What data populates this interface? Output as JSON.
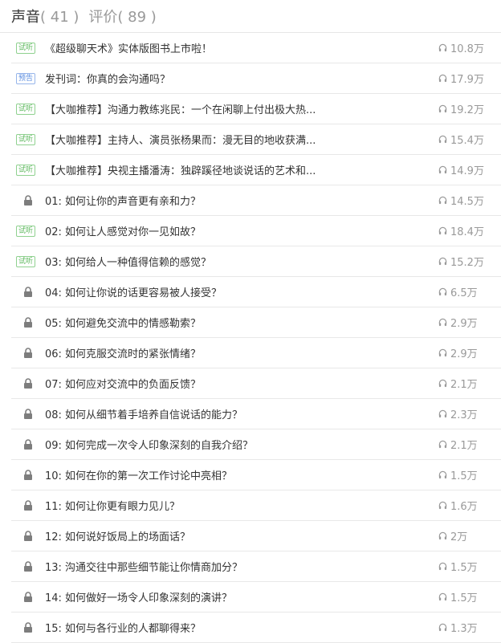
{
  "tabs": [
    {
      "label": "声音",
      "count": "( 41 )",
      "active": true
    },
    {
      "label": "评价",
      "count": "( 89 )",
      "active": false
    }
  ],
  "items": [
    {
      "badge": "试听",
      "badge_type": "trial",
      "title": "《超级聊天术》实体版图书上市啦！",
      "plays": "10.8万"
    },
    {
      "badge": "预告",
      "badge_type": "preview",
      "title": "发刊词：你真的会沟通吗？",
      "plays": "17.9万"
    },
    {
      "badge": "试听",
      "badge_type": "trial",
      "title": "【大咖推荐】沟通力教练兆民：一个在闲聊上付出极大热...",
      "plays": "19.2万"
    },
    {
      "badge": "试听",
      "badge_type": "trial",
      "title": "【大咖推荐】主持人、演员张杨果而：漫无目的地收获满...",
      "plays": "15.4万"
    },
    {
      "badge": "试听",
      "badge_type": "trial",
      "title": "【大咖推荐】央视主播潘涛：独辟蹊径地谈说话的艺术和...",
      "plays": "14.9万"
    },
    {
      "badge": "",
      "badge_type": "lock",
      "title": "01: 如何让你的声音更有亲和力？",
      "plays": "14.5万"
    },
    {
      "badge": "试听",
      "badge_type": "trial",
      "title": "02: 如何让人感觉对你一见如故？",
      "plays": "18.4万"
    },
    {
      "badge": "试听",
      "badge_type": "trial",
      "title": "03: 如何给人一种值得信赖的感觉？",
      "plays": "15.2万"
    },
    {
      "badge": "",
      "badge_type": "lock",
      "title": "04: 如何让你说的话更容易被人接受？",
      "plays": "6.5万"
    },
    {
      "badge": "",
      "badge_type": "lock",
      "title": "05: 如何避免交流中的情感勒索？",
      "plays": "2.9万"
    },
    {
      "badge": "",
      "badge_type": "lock",
      "title": "06: 如何克服交流时的紧张情绪？",
      "plays": "2.9万"
    },
    {
      "badge": "",
      "badge_type": "lock",
      "title": "07: 如何应对交流中的负面反馈？",
      "plays": "2.1万"
    },
    {
      "badge": "",
      "badge_type": "lock",
      "title": "08: 如何从细节着手培养自信说话的能力？",
      "plays": "2.3万"
    },
    {
      "badge": "",
      "badge_type": "lock",
      "title": "09: 如何完成一次令人印象深刻的自我介绍？",
      "plays": "2.1万"
    },
    {
      "badge": "",
      "badge_type": "lock",
      "title": "10: 如何在你的第一次工作讨论中亮相？",
      "plays": "1.5万"
    },
    {
      "badge": "",
      "badge_type": "lock",
      "title": "11: 如何让你更有眼力见儿？",
      "plays": "1.6万"
    },
    {
      "badge": "",
      "badge_type": "lock",
      "title": "12: 如何说好饭局上的场面话？",
      "plays": "2万"
    },
    {
      "badge": "",
      "badge_type": "lock",
      "title": "13: 沟通交往中那些细节能让你情商加分？",
      "plays": "1.5万"
    },
    {
      "badge": "",
      "badge_type": "lock",
      "title": "14: 如何做好一场令人印象深刻的演讲？",
      "plays": "1.5万"
    },
    {
      "badge": "",
      "badge_type": "lock",
      "title": "15: 如何与各行业的人都聊得来？",
      "plays": "1.3万"
    }
  ],
  "colors": {
    "trial": "#5cb85c",
    "preview": "#5b8de0",
    "lock": "#7d7d7d",
    "muted": "#999999"
  },
  "icons": {
    "lock": "lock-icon",
    "plays": "headphones-icon"
  }
}
